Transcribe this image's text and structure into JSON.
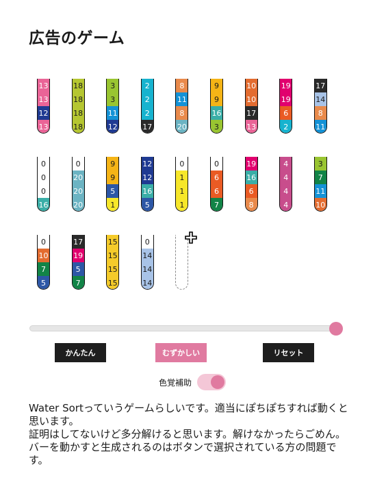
{
  "title": "広告のゲーム",
  "colors": {
    "0": "#ffffff",
    "1": "#f7e72a",
    "2": "#17b3cf",
    "3": "#99c531",
    "4": "#c84d8c",
    "5": "#2d57a6",
    "6": "#ea5b24",
    "7": "#128447",
    "8": "#e98a4b",
    "9": "#f5b416",
    "10": "#e36c30",
    "11": "#1492d6",
    "12": "#1f3a92",
    "13": "#ea6497",
    "14": "#a8c3e7",
    "15": "#f5cb2a",
    "16": "#3aaea7",
    "17": "#2a2a2a",
    "18": "#b5c631",
    "19": "#e1006e",
    "20": "#6cb4c3"
  },
  "tubes": [
    [
      13,
      13,
      12,
      13
    ],
    [
      18,
      18,
      18,
      18
    ],
    [
      3,
      3,
      11,
      12
    ],
    [
      2,
      2,
      2,
      17
    ],
    [
      8,
      11,
      8,
      20
    ],
    [
      9,
      9,
      16,
      3
    ],
    [
      10,
      10,
      17,
      13
    ],
    [
      19,
      19,
      6,
      2
    ],
    [
      17,
      14,
      8,
      11
    ],
    [
      0,
      0,
      0,
      16
    ],
    [
      0,
      20,
      20,
      20
    ],
    [
      9,
      9,
      5,
      1
    ],
    [
      12,
      12,
      16,
      5
    ],
    [
      0,
      1,
      1,
      1
    ],
    [
      0,
      6,
      6,
      7
    ],
    [
      19,
      16,
      6,
      8
    ],
    [
      4,
      4,
      4,
      4
    ],
    [
      3,
      7,
      11,
      10
    ],
    [
      0,
      10,
      7,
      5
    ],
    [
      17,
      19,
      5,
      7
    ],
    [
      15,
      15,
      15,
      15
    ],
    [
      0,
      14,
      14,
      14
    ],
    []
  ],
  "slider": {
    "value": 1.0
  },
  "buttons": {
    "easy": "かんたん",
    "hard": "むずかしい",
    "reset": "リセット"
  },
  "toggle": {
    "label": "色覚補助",
    "on": true
  },
  "description": [
    "Water Sortっていうゲームらしいです。適当にぽちぽちすれば動くと思います。",
    "証明はしてないけど多分解けると思います。解けなかったらごめん。",
    "バーを動かすと生成されるのはボタンで選択されている方の問題です。"
  ]
}
